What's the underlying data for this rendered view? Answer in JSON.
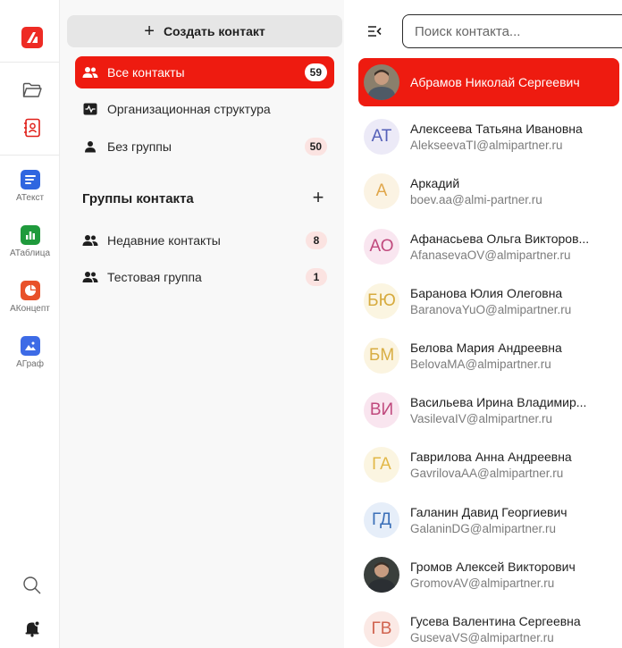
{
  "rail": {
    "apps": [
      {
        "label": "АТекст",
        "color": "#2f66e0",
        "icon": "text-doc-icon"
      },
      {
        "label": "АТаблица",
        "color": "#1f9a3c",
        "icon": "bar-chart-icon"
      },
      {
        "label": "АКонцепт",
        "color": "#e8512a",
        "icon": "pie-chart-icon"
      },
      {
        "label": "АГраф",
        "color": "#3d6be6",
        "icon": "image-icon"
      }
    ]
  },
  "groups": {
    "create_label": "Создать контакт",
    "items": [
      {
        "label": "Все контакты",
        "count": "59",
        "icon": "people-icon"
      },
      {
        "label": "Организационная структура",
        "count": "",
        "icon": "org-structure-icon"
      },
      {
        "label": "Без группы",
        "count": "50",
        "icon": "person-icon"
      }
    ],
    "section_title": "Группы контакта",
    "contact_groups": [
      {
        "label": "Недавние контакты",
        "count": "8",
        "icon": "people-icon"
      },
      {
        "label": "Тестовая группа",
        "count": "1",
        "icon": "people-icon"
      }
    ]
  },
  "list": {
    "search_placeholder": "Поиск контакта...",
    "contacts": [
      {
        "name": "Абрамов Николай Сергеевич",
        "email": "",
        "initials": "",
        "photo": true,
        "bg": "",
        "fg": ""
      },
      {
        "name": "Алексеева Татьяна Ивановна",
        "email": "AlekseevaTI@almipartner.ru",
        "initials": "АТ",
        "bg": "#eceaf7",
        "fg": "#5560b8"
      },
      {
        "name": "Аркадий",
        "email": "boev.aa@almi-partner.ru",
        "initials": "А",
        "bg": "#fbf3e3",
        "fg": "#e0a64a"
      },
      {
        "name": "Афанасьева Ольга Викторов...",
        "email": "AfanasevaOV@almipartner.ru",
        "initials": "АО",
        "bg": "#f9e6f0",
        "fg": "#c0497d"
      },
      {
        "name": "Баранова Юлия Олеговна",
        "email": "BaranovaYuO@almipartner.ru",
        "initials": "БЮ",
        "bg": "#fbf5e1",
        "fg": "#d7ab3e"
      },
      {
        "name": "Белова Мария Андреевна",
        "email": "BelovaMA@almipartner.ru",
        "initials": "БМ",
        "bg": "#fbf4e0",
        "fg": "#d8ad43"
      },
      {
        "name": "Васильева Ирина Владимир...",
        "email": "VasilevaIV@almipartner.ru",
        "initials": "ВИ",
        "bg": "#f9e5ef",
        "fg": "#c0497d"
      },
      {
        "name": "Гаврилова Анна Андреевна",
        "email": "GavrilovaAA@almipartner.ru",
        "initials": "ГА",
        "bg": "#fbf5e1",
        "fg": "#e2b847"
      },
      {
        "name": "Галанин Давид Георгиевич",
        "email": "GalaninDG@almipartner.ru",
        "initials": "ГД",
        "bg": "#e6eef9",
        "fg": "#3b6fb8"
      },
      {
        "name": "Громов Алексей Викторович",
        "email": "GromovAV@almipartner.ru",
        "initials": "",
        "photo": true,
        "bg": "",
        "fg": ""
      },
      {
        "name": "Гусева Валентина Сергеевна",
        "email": "GusevaVS@almipartner.ru",
        "initials": "ГВ",
        "bg": "#fbe9e5",
        "fg": "#d0634f"
      }
    ]
  }
}
